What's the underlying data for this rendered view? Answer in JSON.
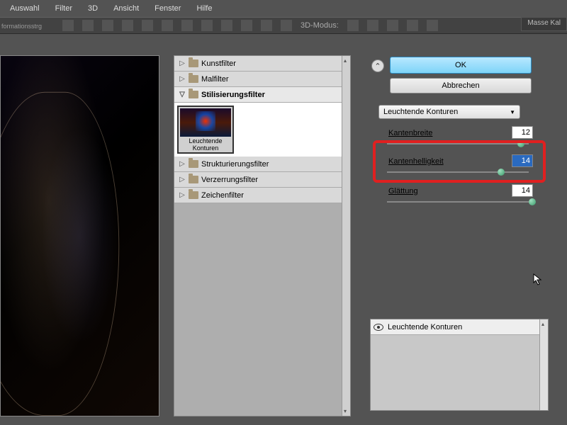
{
  "menu": {
    "auswahl": "Auswahl",
    "filter": "Filter",
    "dreid": "3D",
    "ansicht": "Ansicht",
    "fenster": "Fenster",
    "hilfe": "Hilfe"
  },
  "toolbar": {
    "transform_label": "formationsstrg",
    "mode_3d": "3D-Modus:",
    "right_tab": "Masse Kal"
  },
  "filters": {
    "kunstfilter": "Kunstfilter",
    "malfilter": "Malfilter",
    "stilisierung": "Stilisierungsfilter",
    "thumb_label": "Leuchtende Konturen",
    "strukturierung": "Strukturierungsfilter",
    "verzerrung": "Verzerrungsfilter",
    "zeichen": "Zeichenfilter"
  },
  "controls": {
    "ok": "OK",
    "cancel": "Abbrechen",
    "effect": "Leuchtende Konturen",
    "param1_label": "Kantenbreite",
    "param1_value": "12",
    "param2_label": "Kantenhelligkeit",
    "param2_value": "14",
    "param3_label": "Glättung",
    "param3_value": "14"
  },
  "layers": {
    "row1": "Leuchtende Konturen"
  }
}
